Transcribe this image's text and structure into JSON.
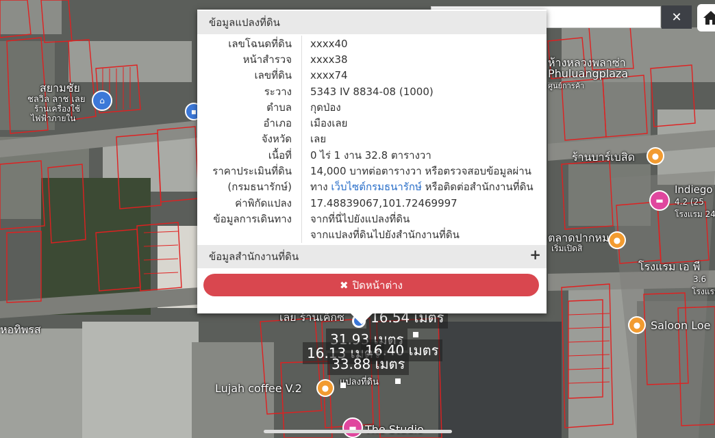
{
  "map": {
    "labels": {
      "phuluang_thai": "ห้างหลวงพลาซ่า",
      "phuluang_en": "Phuluangplaza",
      "phuluang_sub": "ศูนย์การค้า",
      "bank_1": "สยามชัย",
      "bank_2": "ชลวิล ลาช เลย",
      "bank_3": "ร้านเครื่องใช้",
      "bank_4": "ไฟฟ้าภายใน",
      "cake_shop": "ร้านบาร์เบสิด",
      "indiego_1": "Indiego",
      "indiego_2": "4.2 (25",
      "indiego_3": "โรงแรม 24",
      "market": "ตลาดปากหมา",
      "market_sub": "เริ่มเปิดสิ",
      "hotel_1": "โรงแรม เอ พี",
      "hotel_2": "3.6",
      "hotel_3": "โรงแรม",
      "saloon": "Saloon Loe",
      "pharmacy": "หอทิพรส",
      "lujah": "Lujah coffee V.2",
      "studio": "The Studio",
      "shop_name": "เลย ร้านเค็กซ",
      "parcel_label": "แปลงที่ดิน"
    },
    "measurements": {
      "m1": "16.54 เมตร",
      "m2": "31.93 เมตร",
      "m3": "16.13 เมตร",
      "m4": "16.40 เมตร",
      "m5": "33.88 เมตร"
    }
  },
  "search": {
    "value": "'",
    "close_label": "✕"
  },
  "popup": {
    "title": "ข้อมูลแปลงที่ดิน",
    "rows": [
      {
        "label": "เลขโฉนดที่ดิน",
        "value": "xxxx40"
      },
      {
        "label": "หน้าสำรวจ",
        "value": "xxxx38"
      },
      {
        "label": "เลขที่ดิน",
        "value": "xxxx74"
      },
      {
        "label": "ระวาง",
        "value": "5343 IV 8834-08 (1000)"
      },
      {
        "label": "ตำบล",
        "value": "กุดป่อง"
      },
      {
        "label": "อำเภอ",
        "value": "เมืองเลย"
      },
      {
        "label": "จังหวัด",
        "value": "เลย"
      },
      {
        "label": "เนื้อที่",
        "value": "0 ไร่ 1 งาน 32.8 ตารางวา"
      },
      {
        "label": "ราคาประเมินที่ดิน",
        "value": "14,000 บาทต่อตารางวา หรือตรวจสอบข้อมูลผ่าน"
      },
      {
        "label": "(กรมธนารักษ์)",
        "value_pre": "ทาง ",
        "value_link": "เว็บไซต์กรมธนารักษ์",
        "value_post": " หรือติดต่อสำนักงานที่ดิน"
      },
      {
        "label": "ค่าพิกัดแปลง",
        "link": "17.48839067,101.72469997"
      },
      {
        "label": "ข้อมูลการเดินทาง",
        "link": "จากที่นี่ไปยังแปลงที่ดิน"
      },
      {
        "label": "",
        "link": "จากแปลงที่ดินไปยังสำนักงานที่ดิน"
      }
    ],
    "office_section": "ข้อมูลสำนักงานที่ดิน",
    "office_toggle": "+",
    "close_button": "ปิดหน้าต่าง"
  },
  "colors": {
    "accent_red": "#d9474f",
    "link_blue": "#2a6fc9",
    "parcel_line": "#e02020"
  }
}
